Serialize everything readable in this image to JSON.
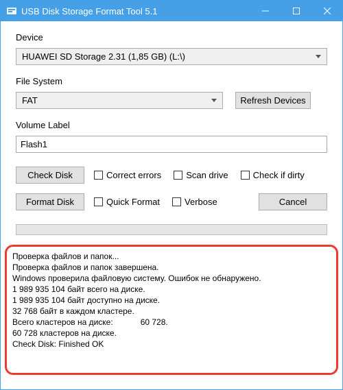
{
  "window": {
    "title": "USB Disk Storage Format Tool 5.1"
  },
  "labels": {
    "device": "Device",
    "filesystem": "File System",
    "volumelabel": "Volume Label"
  },
  "device": {
    "selected": "HUAWEI  SD Storage  2.31 (1,85 GB) (L:\\)"
  },
  "filesystem": {
    "selected": "FAT"
  },
  "buttons": {
    "refresh": "Refresh Devices",
    "checkdisk": "Check Disk",
    "formatdisk": "Format Disk",
    "cancel": "Cancel"
  },
  "volume": {
    "value": "Flash1"
  },
  "checks": {
    "correct_errors": "Correct errors",
    "scan_drive": "Scan drive",
    "check_if_dirty": "Check if dirty",
    "quick_format": "Quick Format",
    "verbose": "Verbose"
  },
  "log": [
    "Проверка файлов и папок...",
    "Проверка файлов и папок завершена.",
    "Windows проверила файловую систему. Ошибок не обнаружено.",
    "1 989 935 104 байт всего на диске.",
    "1 989 935 104 байт доступно на диске.",
    "32 768 байт в каждом кластере.",
    "Всего кластеров на диске:            60 728.",
    "60 728 кластеров на диске.",
    "Check Disk: Finished OK"
  ]
}
